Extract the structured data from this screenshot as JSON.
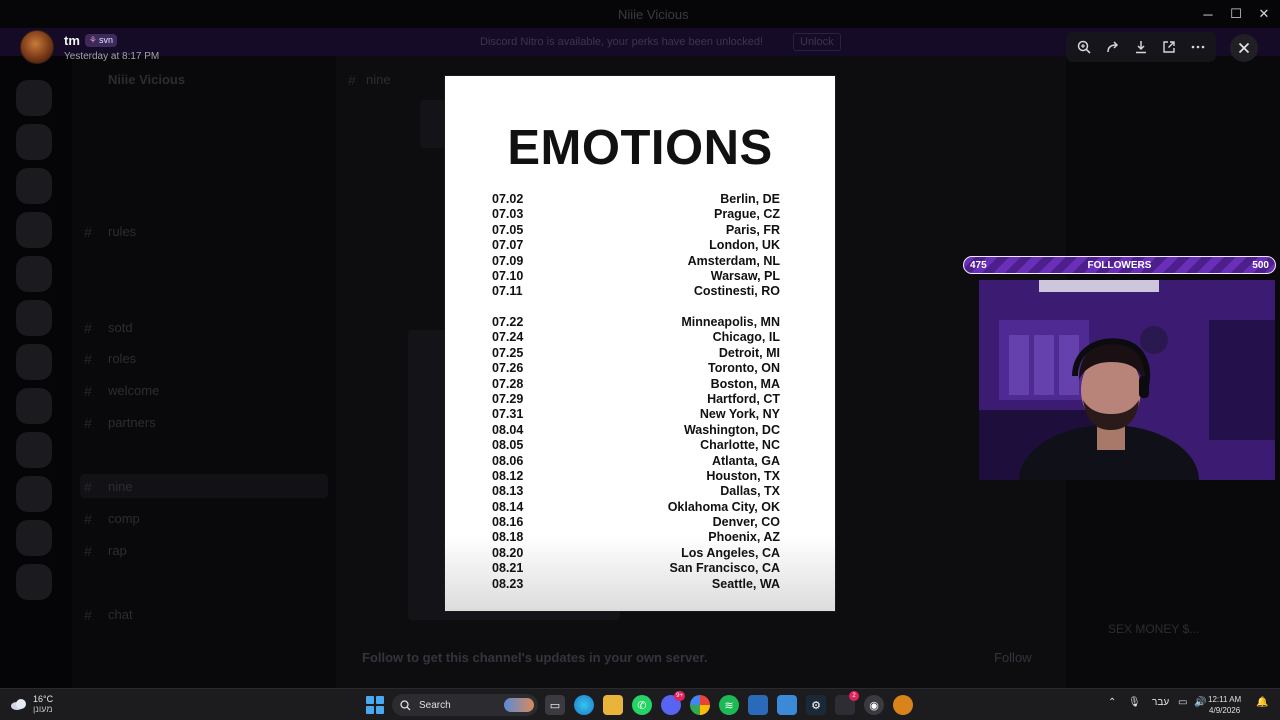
{
  "window": {
    "title": "Niiie Vicious"
  },
  "notice": {
    "text": "Discord Nitro is available, your perks have been unlocked!",
    "action": "Unlock"
  },
  "background": {
    "server_name": "Niiie Vicious",
    "channel_items": [
      "rules",
      "sotd",
      "roles",
      "welcome",
      "partners",
      "nine",
      "comp",
      "rap",
      "chat"
    ],
    "chat_channel": "nine",
    "follow_prompt": "Follow to get this channel's updates in your own server.",
    "follow_button": "Follow",
    "member_snippet": "SEX MONEY $..."
  },
  "viewer": {
    "username": "tm",
    "tag": "svn",
    "timestamp": "Yesterday at 8:17 PM"
  },
  "toolbar": {
    "icons": [
      "zoom-icon",
      "forward-icon",
      "download-icon",
      "open-external-icon",
      "more-icon"
    ],
    "close_icon": "close-icon"
  },
  "poster": {
    "title": "EMOTIONS",
    "europe": [
      {
        "date": "07.02",
        "city": "Berlin, DE"
      },
      {
        "date": "07.03",
        "city": "Prague, CZ"
      },
      {
        "date": "07.05",
        "city": "Paris, FR"
      },
      {
        "date": "07.07",
        "city": "London, UK"
      },
      {
        "date": "07.09",
        "city": "Amsterdam, NL"
      },
      {
        "date": "07.10",
        "city": "Warsaw, PL"
      },
      {
        "date": "07.11",
        "city": "Costinesti, RO"
      }
    ],
    "north_america": [
      {
        "date": "07.22",
        "city": "Minneapolis, MN"
      },
      {
        "date": "07.24",
        "city": "Chicago, IL"
      },
      {
        "date": "07.25",
        "city": "Detroit, MI"
      },
      {
        "date": "07.26",
        "city": "Toronto, ON"
      },
      {
        "date": "07.28",
        "city": "Boston, MA"
      },
      {
        "date": "07.29",
        "city": "Hartford, CT"
      },
      {
        "date": "07.31",
        "city": "New York, NY"
      },
      {
        "date": "08.04",
        "city": "Washington, DC"
      },
      {
        "date": "08.05",
        "city": "Charlotte, NC"
      },
      {
        "date": "08.06",
        "city": "Atlanta, GA"
      },
      {
        "date": "08.12",
        "city": "Houston, TX"
      },
      {
        "date": "08.13",
        "city": "Dallas, TX"
      },
      {
        "date": "08.14",
        "city": "Oklahoma City, OK"
      },
      {
        "date": "08.16",
        "city": "Denver, CO"
      },
      {
        "date": "08.18",
        "city": "Phoenix, AZ"
      },
      {
        "date": "08.20",
        "city": "Los Angeles, CA"
      },
      {
        "date": "08.21",
        "city": "San Francisco, CA"
      },
      {
        "date": "08.23",
        "city": "Seattle, WA"
      }
    ]
  },
  "followers": {
    "current": "475",
    "label": "FOLLOWERS",
    "goal": "500",
    "progress": 0.95
  },
  "taskbar": {
    "weather_temp": "16°C",
    "weather_condition": "מעונן",
    "search_label": "Search",
    "language": "עבר",
    "time": "12:11 AM",
    "date": "4/9/2026",
    "discord_badge": "9+",
    "app_badge": "2",
    "accent": "#4aa8f0"
  }
}
